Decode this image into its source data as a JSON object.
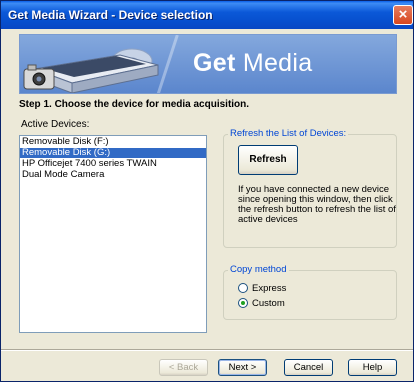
{
  "window": {
    "title": "Get Media Wizard - Device selection",
    "close_icon": "close-icon"
  },
  "banner": {
    "brand": "Get",
    "title_rest": " Media",
    "icon": "scanner-camera-icon"
  },
  "step_text": "Step 1. Choose the device for media acquisition.",
  "devices": {
    "label": "Active Devices:",
    "items": [
      {
        "label": "Removable Disk (F:)",
        "selected": false
      },
      {
        "label": "Removable Disk (G:)",
        "selected": true
      },
      {
        "label": "HP Officejet 7400 series TWAIN",
        "selected": false
      },
      {
        "label": "Dual Mode Camera",
        "selected": false
      }
    ]
  },
  "refresh": {
    "group_label": "Refresh the List of Devices:",
    "button_label": "Refresh",
    "description": "If you have connected a new device since opening this window, then click the refresh button to refresh the list of active devices"
  },
  "copy_method": {
    "group_label": "Copy method",
    "options": [
      {
        "label": "Express",
        "checked": false
      },
      {
        "label": "Custom",
        "checked": true
      }
    ]
  },
  "footer": {
    "back": "< Back",
    "next": "Next >",
    "cancel": "Cancel",
    "help": "Help"
  },
  "colors": {
    "titlebar": "#0b58d8",
    "selection": "#316ac5",
    "group_label": "#0046d5",
    "face": "#ece9d8"
  }
}
